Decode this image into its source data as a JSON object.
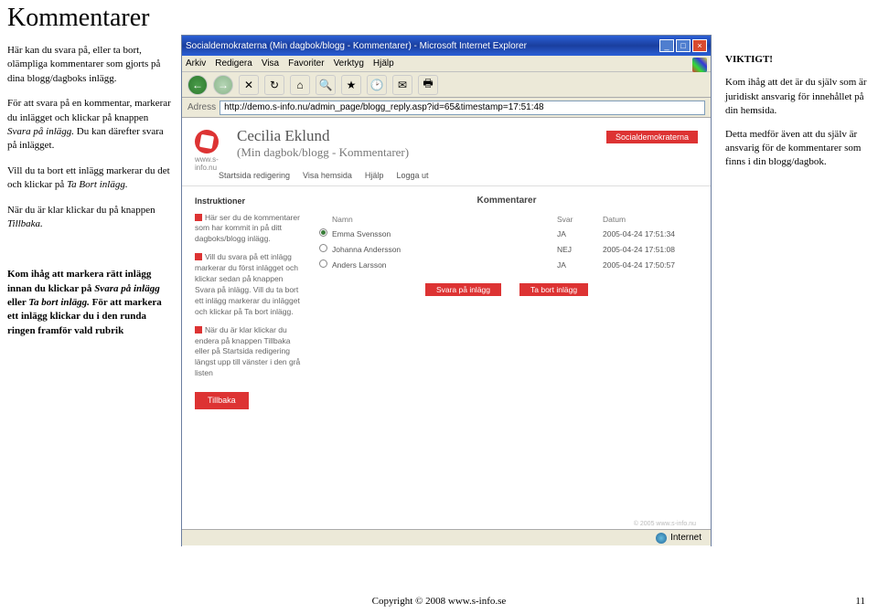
{
  "page": {
    "title": "Kommentarer",
    "copyright": "Copyright © 2008 www.s-info.se",
    "page_number": "11"
  },
  "left": {
    "p1a": "Här kan du svara på, eller ta bort, olämpliga kommentarer som gjorts på dina blogg/dagboks inlägg.",
    "p2a": "För att svara på en kommentar, markerar du inlägget och klickar på knappen ",
    "p2i": "Svara på inlägg.",
    "p2b": " Du kan därefter svara på inlägget.",
    "p3a": "Vill du ta bort ett inlägg markerar du det och klickar på ",
    "p3i": "Ta Bort inlägg.",
    "p4a": "När du är klar klickar du på knappen ",
    "p4i": "Tillbaka.",
    "p5a": "Kom ihåg att markera rätt inlägg innan du klickar på ",
    "p5i1": "Svara på inlägg",
    "p5b": " eller ",
    "p5i2": "Ta bort inlägg.",
    "p5c": " För att markera ett inlägg klickar du i den runda ringen framför vald rubrik"
  },
  "right": {
    "h": "VIKTIGT!",
    "p1": "Kom ihåg att det är du själv som är juridiskt ansvarig för innehållet på din hemsida.",
    "p2": "Detta medför även att du själv är ansvarig för de kommentarer som finns i din blogg/dagbok."
  },
  "browser": {
    "title": "Socialdemokraterna (Min dagbok/blogg - Kommentarer) - Microsoft Internet Explorer",
    "menu": {
      "arkiv": "Arkiv",
      "redigera": "Redigera",
      "visa": "Visa",
      "favoriter": "Favoriter",
      "verktyg": "Verktyg",
      "hjalp": "Hjälp"
    },
    "address_label": "Adress",
    "address": "http://demo.s-info.nu/admin_page/blogg_reply.asp?id=65&timestamp=17:51:48",
    "status": "Internet"
  },
  "content": {
    "site": "www.s-info.nu",
    "name": "Cecilia Eklund",
    "subtitle": "(Min dagbok/blogg - Kommentarer)",
    "tag": "Socialdemokraterna",
    "nav": {
      "n1": "Startsida redigering",
      "n2": "Visa hemsida",
      "n3": "Hjälp",
      "n4": "Logga ut"
    },
    "instr_h": "Instruktioner",
    "instr1": "Här ser du de kommentarer som har kommit in på ditt dagboks/blogg inlägg.",
    "instr2": "Vill du svara på ett inlägg markerar du först inlägget och klickar sedan på knappen Svara på inlägg. Vill du ta bort ett inlägg markerar du inlägget och klickar på Ta bort inlägg.",
    "instr3": "När du är klar klickar du endera på knappen Tillbaka eller på Startsida redigering längst upp till vänster i den grå listen",
    "back": "Tillbaka",
    "main_h": "Kommentarer",
    "th": {
      "namn": "Namn",
      "svar": "Svar",
      "datum": "Datum"
    },
    "rows": [
      {
        "name": "Emma Svensson",
        "svar": "JA",
        "datum": "2005-04-24 17:51:34",
        "selected": true
      },
      {
        "name": "Johanna Andersson",
        "svar": "NEJ",
        "datum": "2005-04-24 17:51:08",
        "selected": false
      },
      {
        "name": "Anders Larsson",
        "svar": "JA",
        "datum": "2005-04-24 17:50:57",
        "selected": false
      }
    ],
    "btn_svara": "Svara på inlägg",
    "btn_tabort": "Ta bort inlägg",
    "footer": "© 2005 www.s-info.nu"
  }
}
